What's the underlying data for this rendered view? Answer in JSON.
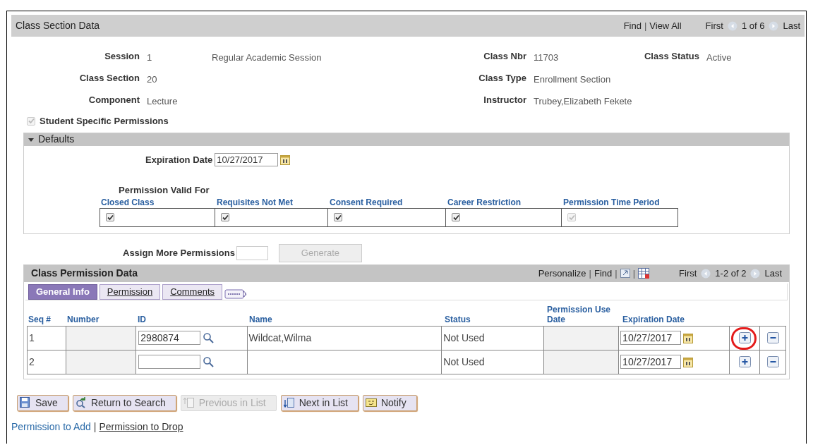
{
  "section": {
    "title": "Class Section Data",
    "separator": "|",
    "nav": [
      "Find",
      "View All"
    ],
    "first": "First",
    "count": "1 of 6",
    "last": "Last"
  },
  "field_rows": [
    [
      {
        "label": "Session",
        "value": "1",
        "description": "Regular Academic Session"
      },
      {
        "label": "Class Nbr",
        "value": "11703"
      },
      {
        "label": "Class Status",
        "value": "Active"
      }
    ],
    [
      {
        "label": "Class Section",
        "value": "20"
      },
      {
        "label": "Class Type",
        "value": "Enrollment Section"
      }
    ],
    [
      {
        "label": "Component",
        "value": "Lecture"
      },
      {
        "label": "Instructor",
        "value": "Trubey,Elizabeth Fekete"
      }
    ]
  ],
  "student_specific": {
    "label": "Student Specific Permissions",
    "checked": true,
    "disabled": true
  },
  "defaults": {
    "title": "Defaults",
    "expanded": true,
    "expiration_label": "Expiration Date",
    "expiration_value": "10/27/2017",
    "valid_for_label": "Permission Valid For",
    "options": [
      {
        "label": "Closed Class",
        "checked": true,
        "disabled": false
      },
      {
        "label": "Requisites Not Met",
        "checked": true,
        "disabled": false
      },
      {
        "label": "Consent Required",
        "checked": true,
        "disabled": false
      },
      {
        "label": "Career Restriction",
        "checked": true,
        "disabled": false
      },
      {
        "label": "Permission Time Period",
        "checked": true,
        "disabled": true
      }
    ]
  },
  "assign": {
    "label": "Assign More Permissions",
    "button": "Generate",
    "button_disabled": true
  },
  "grid": {
    "title": "Class Permission Data",
    "separator": "|",
    "actions": [
      "Personalize",
      "Find"
    ],
    "first": "First",
    "count": "1-2 of 2",
    "last": "Last",
    "tabs": [
      {
        "label": "General Info",
        "selected": true
      },
      {
        "label": "Permission",
        "selected": false
      },
      {
        "label": "Comments",
        "selected": false
      }
    ],
    "columns": [
      "Seq #",
      "Number",
      "ID",
      "Name",
      "Status",
      "Permission Use Date",
      "Expiration Date"
    ],
    "rows": [
      {
        "seq": "1",
        "id": "2980874",
        "name": "Wildcat,Wilma",
        "status": "Not Used",
        "expiration": "10/27/2017",
        "add_highlighted": true
      },
      {
        "seq": "2",
        "status": "Not Used",
        "expiration": "10/27/2017",
        "add_highlighted": false
      }
    ]
  },
  "buttons": [
    {
      "label": "Save",
      "kind": "save",
      "disabled": false
    },
    {
      "label": "Return to Search",
      "kind": "return",
      "disabled": false
    },
    {
      "label": "Previous in List",
      "kind": "previous",
      "disabled": true
    },
    {
      "label": "Next in List",
      "kind": "next",
      "disabled": false
    },
    {
      "label": "Notify",
      "kind": "notify",
      "disabled": false
    }
  ],
  "link_separator": "|",
  "links": [
    {
      "label": "Permission to Add",
      "visited": false
    },
    {
      "label": "Permission to Drop",
      "visited": true
    }
  ]
}
